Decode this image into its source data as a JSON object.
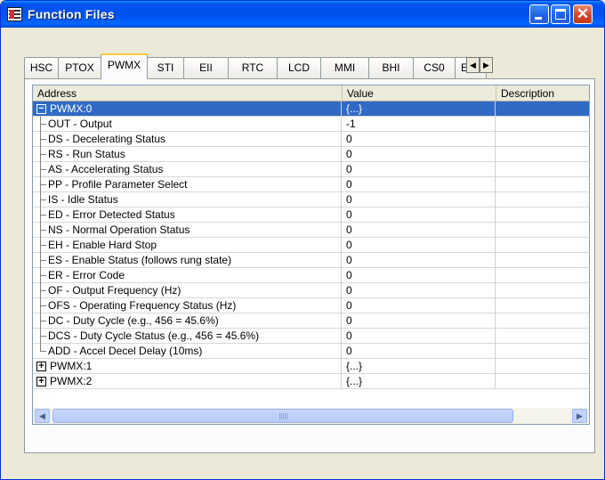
{
  "window": {
    "title": "Function Files"
  },
  "tabs": [
    {
      "label": "HSC",
      "active": false
    },
    {
      "label": "PTOX",
      "active": false
    },
    {
      "label": "PWMX",
      "active": true
    },
    {
      "label": "STI",
      "active": false
    },
    {
      "label": "EII",
      "active": false
    },
    {
      "label": "RTC",
      "active": false
    },
    {
      "label": "LCD",
      "active": false
    },
    {
      "label": "MMI",
      "active": false
    },
    {
      "label": "BHI",
      "active": false
    },
    {
      "label": "CS0",
      "active": false
    },
    {
      "label": "E",
      "active": false
    }
  ],
  "columns": {
    "address": "Address",
    "value": "Value",
    "description": "Description"
  },
  "rows": [
    {
      "address": "PWMX:0",
      "value": "{...}",
      "type": "parent",
      "expander": "−"
    },
    {
      "address": "OUT - Output",
      "value": "-1",
      "type": "child"
    },
    {
      "address": "DS - Decelerating Status",
      "value": "0",
      "type": "child"
    },
    {
      "address": "RS - Run Status",
      "value": "0",
      "type": "child"
    },
    {
      "address": "AS - Accelerating Status",
      "value": "0",
      "type": "child"
    },
    {
      "address": "PP - Profile Parameter Select",
      "value": "0",
      "type": "child"
    },
    {
      "address": "IS - Idle Status",
      "value": "0",
      "type": "child"
    },
    {
      "address": "ED - Error Detected Status",
      "value": "0",
      "type": "child"
    },
    {
      "address": "NS - Normal Operation Status",
      "value": "0",
      "type": "child"
    },
    {
      "address": "EH - Enable Hard Stop",
      "value": "0",
      "type": "child"
    },
    {
      "address": "ES - Enable Status (follows rung state)",
      "value": "0",
      "type": "child"
    },
    {
      "address": "ER - Error Code",
      "value": "0",
      "type": "child"
    },
    {
      "address": "OF - Output Frequency (Hz)",
      "value": "0",
      "type": "child"
    },
    {
      "address": "OFS - Operating Frequency Status (Hz)",
      "value": "0",
      "type": "child"
    },
    {
      "address": "DC - Duty Cycle (e.g., 456 = 45.6%)",
      "value": "0",
      "type": "child"
    },
    {
      "address": "DCS - Duty Cycle Status (e.g., 456 = 45.6%)",
      "value": "0",
      "type": "child"
    },
    {
      "address": "ADD - Accel Decel Delay (10ms)",
      "value": "0",
      "type": "child"
    },
    {
      "address": "PWMX:1",
      "value": "{...}",
      "type": "parent",
      "expander": "+"
    },
    {
      "address": "PWMX:2",
      "value": "{...}",
      "type": "parent",
      "expander": "+"
    }
  ],
  "selected_row": 0,
  "icons": {
    "app": "function-files-icon",
    "minimize": "minimize-icon",
    "maximize": "maximize-icon",
    "close": "close-icon",
    "tab_scroll_left": "arrow-left-icon",
    "tab_scroll_right": "arrow-right-icon",
    "scroll_left": "arrow-left-icon",
    "scroll_right": "arrow-right-icon"
  },
  "glyphs": {
    "close": "✕",
    "tab_left": "◀",
    "tab_right": "▶",
    "scroll_left": "◀",
    "scroll_right": "▶"
  },
  "colors": {
    "titlebar": "#0053ee",
    "selection": "#316ac5",
    "active_tab_accent": "#ffc83c",
    "window_bg": "#ece9d8"
  }
}
